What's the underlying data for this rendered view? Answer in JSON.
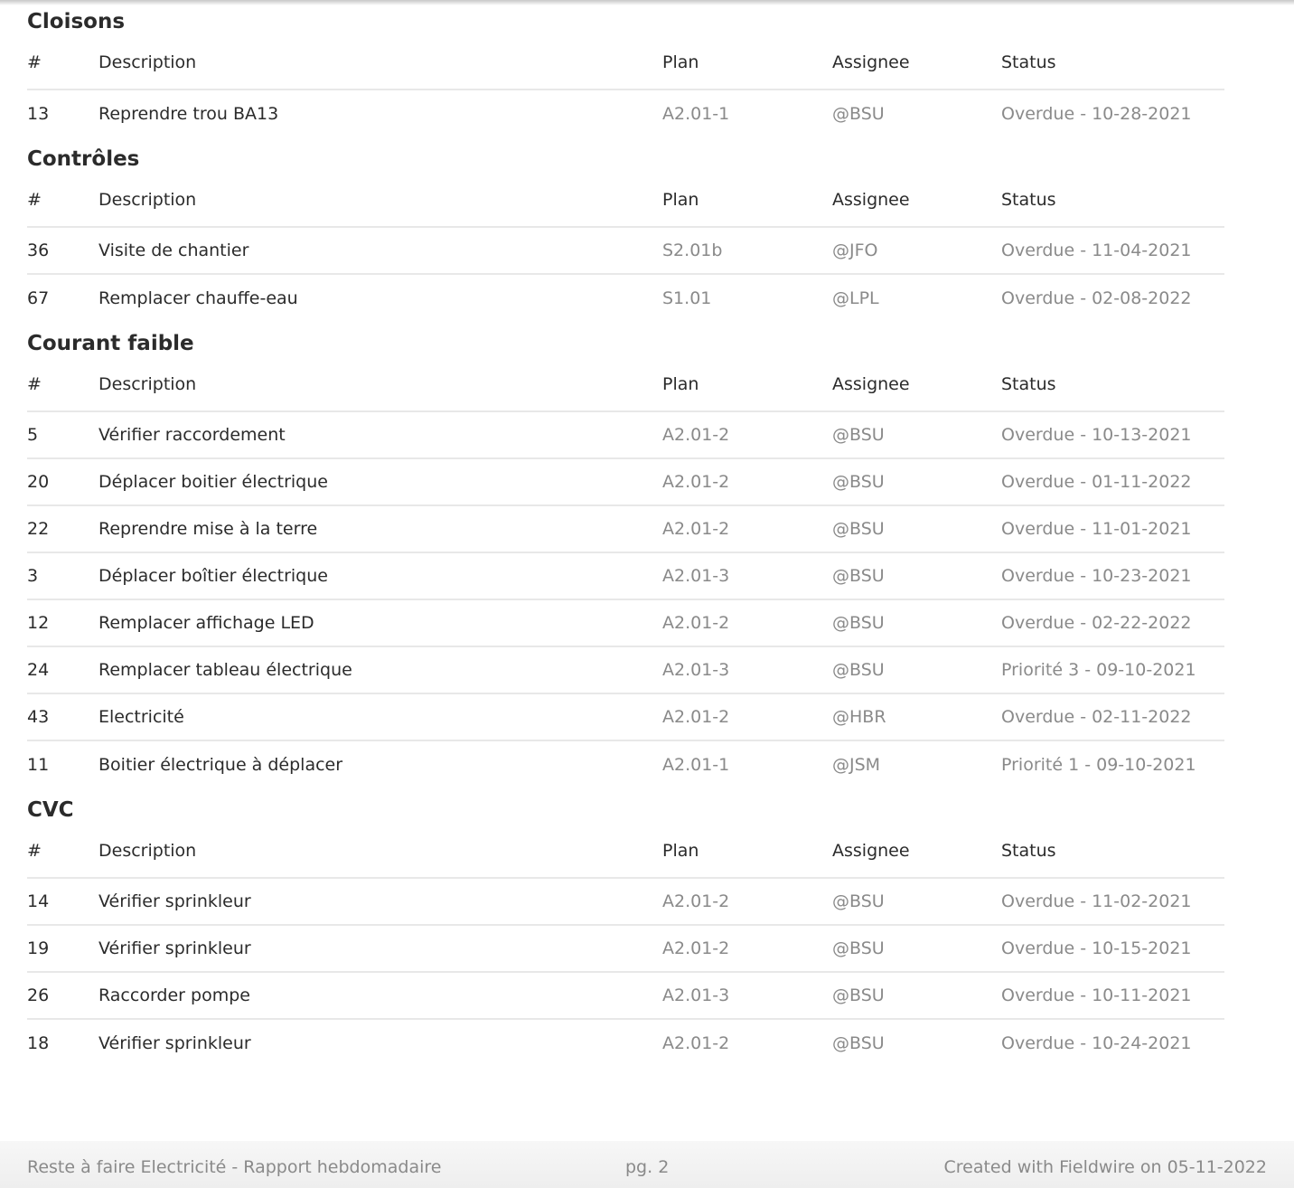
{
  "columns": {
    "num": "#",
    "description": "Description",
    "plan": "Plan",
    "assignee": "Assignee",
    "status": "Status"
  },
  "sections": [
    {
      "title": "Cloisons",
      "rows": [
        {
          "num": "13",
          "description": "Reprendre trou BA13",
          "plan": "A2.01-1",
          "assignee": "@BSU",
          "status": "Overdue - 10-28-2021"
        }
      ]
    },
    {
      "title": "Contrôles",
      "rows": [
        {
          "num": "36",
          "description": "Visite de chantier",
          "plan": "S2.01b",
          "assignee": "@JFO",
          "status": "Overdue - 11-04-2021"
        },
        {
          "num": "67",
          "description": "Remplacer chauffe-eau",
          "plan": "S1.01",
          "assignee": "@LPL",
          "status": "Overdue - 02-08-2022"
        }
      ]
    },
    {
      "title": "Courant faible",
      "rows": [
        {
          "num": "5",
          "description": "Vérifier raccordement",
          "plan": "A2.01-2",
          "assignee": "@BSU",
          "status": "Overdue - 10-13-2021"
        },
        {
          "num": "20",
          "description": "Déplacer boitier électrique",
          "plan": "A2.01-2",
          "assignee": "@BSU",
          "status": "Overdue - 01-11-2022"
        },
        {
          "num": "22",
          "description": "Reprendre mise à la terre",
          "plan": "A2.01-2",
          "assignee": "@BSU",
          "status": "Overdue - 11-01-2021"
        },
        {
          "num": "3",
          "description": "Déplacer boîtier électrique",
          "plan": "A2.01-3",
          "assignee": "@BSU",
          "status": "Overdue - 10-23-2021"
        },
        {
          "num": "12",
          "description": "Remplacer affichage LED",
          "plan": "A2.01-2",
          "assignee": "@BSU",
          "status": "Overdue - 02-22-2022"
        },
        {
          "num": "24",
          "description": "Remplacer tableau électrique",
          "plan": "A2.01-3",
          "assignee": "@BSU",
          "status": "Priorité 3 - 09-10-2021"
        },
        {
          "num": "43",
          "description": "Electricité",
          "plan": "A2.01-2",
          "assignee": "@HBR",
          "status": "Overdue - 02-11-2022"
        },
        {
          "num": "11",
          "description": "Boitier électrique à déplacer",
          "plan": "A2.01-1",
          "assignee": "@JSM",
          "status": "Priorité 1 - 09-10-2021"
        }
      ]
    },
    {
      "title": "CVC",
      "rows": [
        {
          "num": "14",
          "description": "Vérifier sprinkleur",
          "plan": "A2.01-2",
          "assignee": "@BSU",
          "status": "Overdue - 11-02-2021"
        },
        {
          "num": "19",
          "description": "Vérifier sprinkleur",
          "plan": "A2.01-2",
          "assignee": "@BSU",
          "status": "Overdue - 10-15-2021"
        },
        {
          "num": "26",
          "description": "Raccorder pompe",
          "plan": "A2.01-3",
          "assignee": "@BSU",
          "status": "Overdue - 10-11-2021"
        },
        {
          "num": "18",
          "description": "Vérifier sprinkleur",
          "plan": "A2.01-2",
          "assignee": "@BSU",
          "status": "Overdue - 10-24-2021"
        }
      ]
    }
  ],
  "footer": {
    "left": "Reste à faire Electricité - Rapport hebdomadaire",
    "page": "pg. 2",
    "right": "Created with Fieldwire on 05-11-2022"
  }
}
